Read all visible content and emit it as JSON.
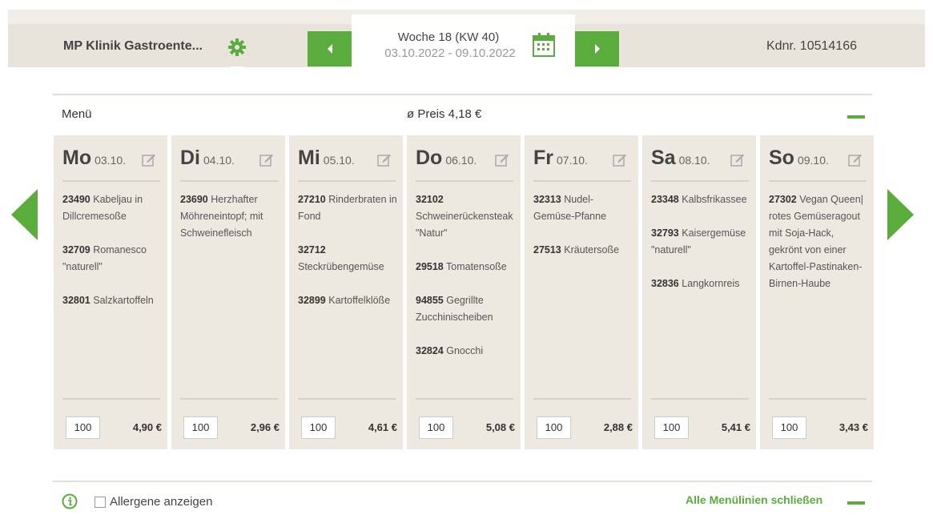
{
  "header": {
    "clinic_name": "MP Klinik Gastroente...",
    "week_title": "Woche 18 (KW 40)",
    "week_range": "03.10.2022 - 09.10.2022",
    "customer_number": "Kdnr. 10514166"
  },
  "menu": {
    "label": "Menü",
    "avg_price": "ø Preis 4,18 €"
  },
  "days": [
    {
      "name": "Mo",
      "date": "03.10.",
      "qty": "100",
      "price": "4,90 €",
      "items": [
        {
          "code": "23490",
          "text": "Kabeljau in Dillcremesoße"
        },
        {
          "code": "32709",
          "text": "Romanesco \"naturell\""
        },
        {
          "code": "32801",
          "text": "Salzkartoffeln"
        }
      ]
    },
    {
      "name": "Di",
      "date": "04.10.",
      "qty": "100",
      "price": "2,96 €",
      "items": [
        {
          "code": "23690",
          "text": "Herzhafter Möhreneintopf; mit Schweinefleisch"
        }
      ]
    },
    {
      "name": "Mi",
      "date": "05.10.",
      "qty": "100",
      "price": "4,61 €",
      "items": [
        {
          "code": "27210",
          "text": "Rinderbraten in Fond"
        },
        {
          "code": "32712",
          "text": "Steckrübengemüse"
        },
        {
          "code": "32899",
          "text": "Kartoffelklöße"
        }
      ]
    },
    {
      "name": "Do",
      "date": "06.10.",
      "qty": "100",
      "price": "5,08 €",
      "items": [
        {
          "code": "32102",
          "text": "Schweinerückensteak \"Natur\""
        },
        {
          "code": "29518",
          "text": "Tomatensoße"
        },
        {
          "code": "94855",
          "text": "Gegrillte Zucchinischeiben"
        },
        {
          "code": "32824",
          "text": "Gnocchi"
        }
      ]
    },
    {
      "name": "Fr",
      "date": "07.10.",
      "qty": "100",
      "price": "2,88 €",
      "items": [
        {
          "code": "32313",
          "text": "Nudel-Gemüse-Pfanne"
        },
        {
          "code": "27513",
          "text": "Kräutersoße"
        }
      ]
    },
    {
      "name": "Sa",
      "date": "08.10.",
      "qty": "100",
      "price": "5,41 €",
      "items": [
        {
          "code": "23348",
          "text": "Kalbsfrikassee"
        },
        {
          "code": "32793",
          "text": "Kaisergemüse \"naturell\""
        },
        {
          "code": "32836",
          "text": "Langkornreis"
        }
      ]
    },
    {
      "name": "So",
      "date": "09.10.",
      "qty": "100",
      "price": "3,43 €",
      "items": [
        {
          "code": "27302",
          "text": "Vegan Queen| rotes Gemüseragout mit Soja-Hack, gekrönt von einer Kartoffel-Pastinaken-Birnen-Haube"
        }
      ]
    }
  ],
  "footer": {
    "allergens_label": "Allergene anzeigen",
    "close_all_label": "Alle Menülinien schließen"
  },
  "colors": {
    "accent": "#5aad3c",
    "header_bg": "#e8e4dc",
    "card_bg": "#ede9e1"
  },
  "icons": {
    "settings": "gear-icon",
    "calendar": "calendar-icon",
    "edit": "edit-icon",
    "info": "info-icon"
  }
}
